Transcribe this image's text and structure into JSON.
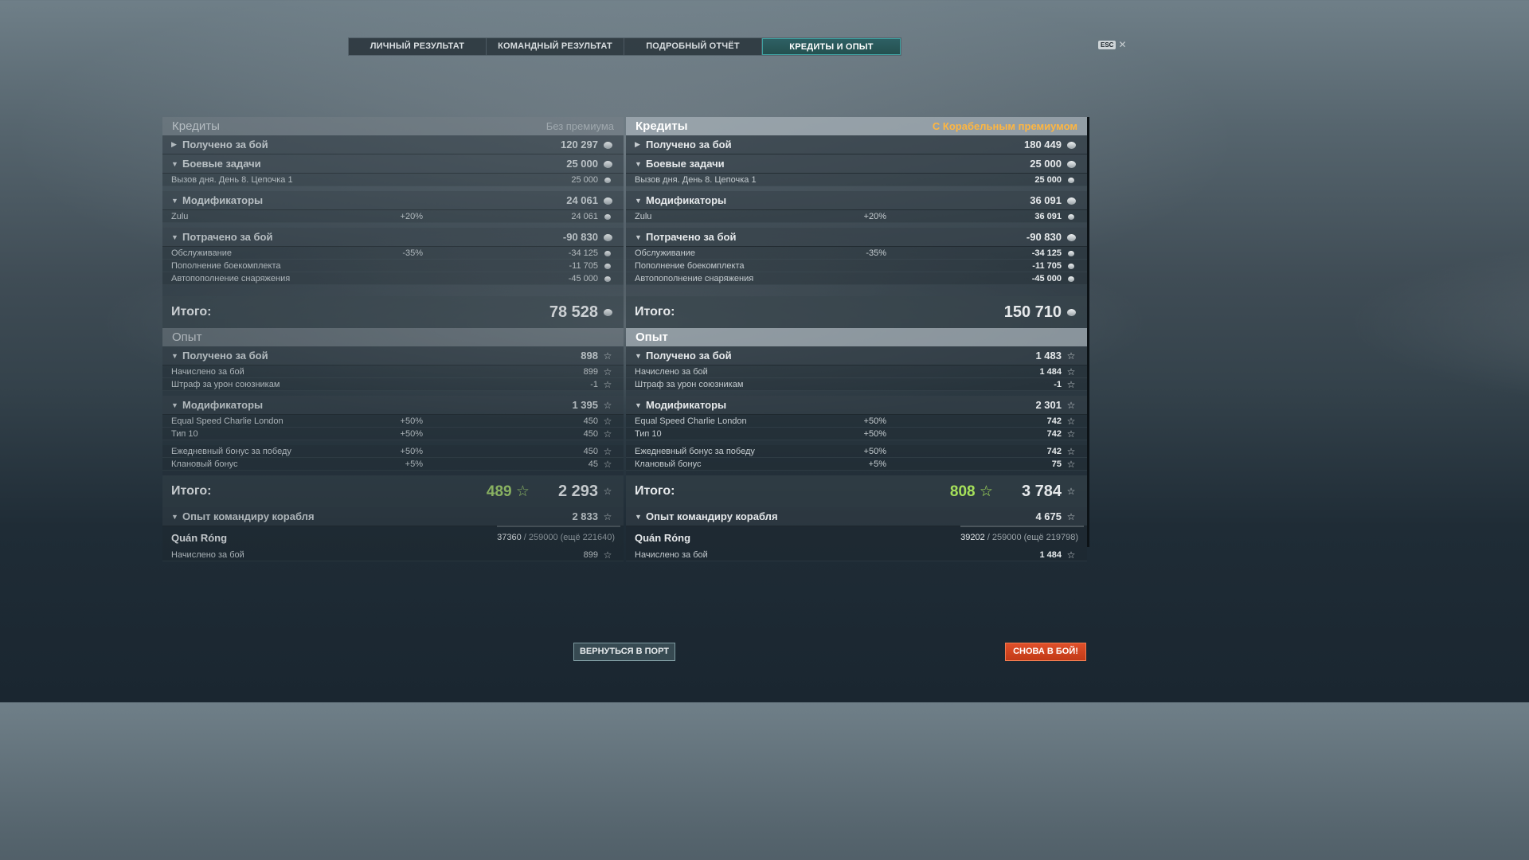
{
  "tabs": [
    {
      "label": "ЛИЧНЫЙ РЕЗУЛЬТАТ"
    },
    {
      "label": "КОМАНДНЫЙ РЕЗУЛЬТАТ"
    },
    {
      "label": "ПОДРОБНЫЙ ОТЧЁТ"
    },
    {
      "label": "КРЕДИТЫ И ОПЫТ"
    }
  ],
  "esc_label": "ESC",
  "esc_close": "✕",
  "left": {
    "credits_title": "Кредиты",
    "credits_sub": "Без премиума",
    "earned_label": "Получено за бой",
    "earned_val": "120 297",
    "tasks_label": "Боевые задачи",
    "tasks_val": "25 000",
    "task_row_label": "Вызов дня. День 8. Цепочка 1",
    "task_row_val": "25 000",
    "mods_label": "Модификаторы",
    "mods_val": "24 061",
    "zulu_label": "Zulu",
    "zulu_pct": "+20%",
    "zulu_val": "24 061",
    "spent_label": "Потрачено за бой",
    "spent_val": "-90 830",
    "service_label": "Обслуживание",
    "service_pct": "-35%",
    "service_val": "-34 125",
    "ammo_label": "Пополнение боекомплекта",
    "ammo_val": "-11 705",
    "consum_label": "Автопополнение снаряжения",
    "consum_val": "-45 000",
    "total_label": "Итого:",
    "credits_total": "78 528",
    "xp_title": "Опыт",
    "xp_earned_label": "Получено за бой",
    "xp_earned_val": "898",
    "xp_accr_label": "Начислено за бой",
    "xp_accr_val": "899",
    "xp_pen_label": "Штраф за урон союзникам",
    "xp_pen_val": "-1",
    "xp_mods_label": "Модификаторы",
    "xp_mods_val": "1 395",
    "m1_label": "Equal Speed Charlie London",
    "m1_pct": "+50%",
    "m1_val": "450",
    "m2_label": "Тип 10",
    "m2_pct": "+50%",
    "m2_val": "450",
    "m3_label": "Ежедневный бонус за победу",
    "m3_pct": "+50%",
    "m3_val": "450",
    "m4_label": "Клановый бонус",
    "m4_pct": "+5%",
    "m4_val": "45",
    "xp_total_free": "489",
    "xp_total": "2 293",
    "cmd_label": "Опыт командиру корабля",
    "cmd_val": "2 833",
    "commander_name": "Quán Róng",
    "commander_cur": "37360",
    "commander_rest": " / 259000 (ещё 221640)",
    "commander_progress": 0.144,
    "cmd_accr_label": "Начислено за бой",
    "cmd_accr_val": "899"
  },
  "right": {
    "credits_title": "Кредиты",
    "credits_sub": "С Корабельным премиумом",
    "earned_label": "Получено за бой",
    "earned_val": "180 449",
    "tasks_label": "Боевые задачи",
    "tasks_val": "25 000",
    "task_row_label": "Вызов дня. День 8. Цепочка 1",
    "task_row_val": "25 000",
    "mods_label": "Модификаторы",
    "mods_val": "36 091",
    "zulu_label": "Zulu",
    "zulu_pct": "+20%",
    "zulu_val": "36 091",
    "spent_label": "Потрачено за бой",
    "spent_val": "-90 830",
    "service_label": "Обслуживание",
    "service_pct": "-35%",
    "service_val": "-34 125",
    "ammo_label": "Пополнение боекомплекта",
    "ammo_val": "-11 705",
    "consum_label": "Автопополнение снаряжения",
    "consum_val": "-45 000",
    "total_label": "Итого:",
    "credits_total": "150 710",
    "xp_title": "Опыт",
    "xp_earned_label": "Получено за бой",
    "xp_earned_val": "1 483",
    "xp_accr_label": "Начислено за бой",
    "xp_accr_val": "1 484",
    "xp_pen_label": "Штраф за урон союзникам",
    "xp_pen_val": "-1",
    "xp_mods_label": "Модификаторы",
    "xp_mods_val": "2 301",
    "m1_label": "Equal Speed Charlie London",
    "m1_pct": "+50%",
    "m1_val": "742",
    "m2_label": "Тип 10",
    "m2_pct": "+50%",
    "m2_val": "742",
    "m3_label": "Ежедневный бонус за победу",
    "m3_pct": "+50%",
    "m3_val": "742",
    "m4_label": "Клановый бонус",
    "m4_pct": "+5%",
    "m4_val": "75",
    "xp_total_free": "808",
    "xp_total": "3 784",
    "cmd_label": "Опыт командиру корабля",
    "cmd_val": "4 675",
    "commander_name": "Quán Róng",
    "commander_cur": "39202",
    "commander_rest": " / 259000 (ещё 219798)",
    "commander_progress": 0.151,
    "cmd_accr_label": "Начислено за бой",
    "cmd_accr_val": "1 484"
  },
  "buttons": {
    "port": "ВЕРНУТЬСЯ В ПОРТ",
    "battle": "СНОВА В БОЙ!"
  },
  "colors": {
    "accent_tab": "#2e6064",
    "premium": "#ffb640",
    "free_xp": "#a5e05a",
    "battle_button": "#d2461f"
  }
}
